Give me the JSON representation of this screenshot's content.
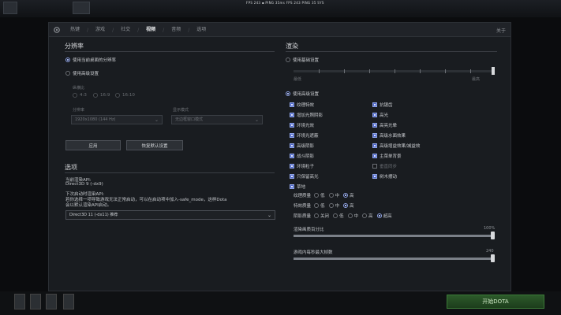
{
  "top_status": {
    "fps_text": "FPS 243 ▪ PING 35ms  FPS 243  PING 35  SYS"
  },
  "dialog": {
    "tabs": [
      "热键",
      "游戏",
      "社交",
      "视频",
      "音频",
      "选项"
    ],
    "active_tab_index": 3,
    "close_label": "关于"
  },
  "resolution": {
    "title": "分辨率",
    "use_desktop": "使用当前桌面的分辨率",
    "use_advanced": "使用高级设置",
    "aspect_label": "纵横比",
    "aspect_options": [
      "4:3",
      "16:9",
      "16:10"
    ],
    "res_label": "分辨率",
    "res_value": "1920x1080 (144 Hz)",
    "display_mode_label": "显示模式",
    "display_mode_value": "无边框窗口模式",
    "apply_label": "应用",
    "restore_label": "恢复默认设置"
  },
  "options": {
    "title": "选项",
    "line1": "当前渲染API:",
    "line2": "Direct3D 9 (-dx9)",
    "line3": "下次启动时渲染API:",
    "line4": "若你选择一项导致游戏无法正常启动，可以在启动项中加入-safe_mode，这样Dota",
    "line5": "会以默认渲染API启动。",
    "api_value": "Direct3D 11 (-dx11) 推荐"
  },
  "rendering": {
    "title": "渲染",
    "basic_label": "使用基础设置",
    "low_label": "最低",
    "high_label": "最高",
    "advanced_label": "使用高级设置",
    "left_checks": [
      {
        "label": "纹理特效",
        "on": true
      },
      {
        "label": "增加光照阴影",
        "on": true
      },
      {
        "label": "环境光效",
        "on": true
      },
      {
        "label": "环境光遮蔽",
        "on": true
      },
      {
        "label": "高级阴影",
        "on": true
      },
      {
        "label": "战斗阴影",
        "on": true
      },
      {
        "label": "环境粒子",
        "on": true
      },
      {
        "label": "只保留高光",
        "on": true
      },
      {
        "label": "草地",
        "on": true
      }
    ],
    "right_checks": [
      {
        "label": "抗锯齿",
        "on": true
      },
      {
        "label": "高光",
        "on": true
      },
      {
        "label": "高亮光晕",
        "on": true
      },
      {
        "label": "高级水面效果",
        "on": true
      },
      {
        "label": "高级增益效果/减益效",
        "on": true
      },
      {
        "label": "主菜单背景",
        "on": true
      },
      {
        "label": "垂直同步",
        "on": false
      },
      {
        "label": "树木摆动",
        "on": true
      }
    ],
    "texture_quality": {
      "label": "纹理质量",
      "options": [
        "低",
        "中",
        "高"
      ],
      "selected": 2
    },
    "effects_quality": {
      "label": "特效质量",
      "options": [
        "低",
        "中",
        "高"
      ],
      "selected": 2
    },
    "shadow_quality": {
      "label": "阴影质量",
      "options": [
        "关闭",
        "低",
        "中",
        "高",
        "超高"
      ],
      "selected": 4
    },
    "render_scale": {
      "label": "渲染画质百分比",
      "value": "100%",
      "fraction": 1.0
    },
    "max_fps": {
      "label": "游戏内每秒最大帧数",
      "value": "240",
      "fraction": 1.0
    }
  },
  "bottom": {
    "play_label": "开始DOTA",
    "center_text": ""
  }
}
